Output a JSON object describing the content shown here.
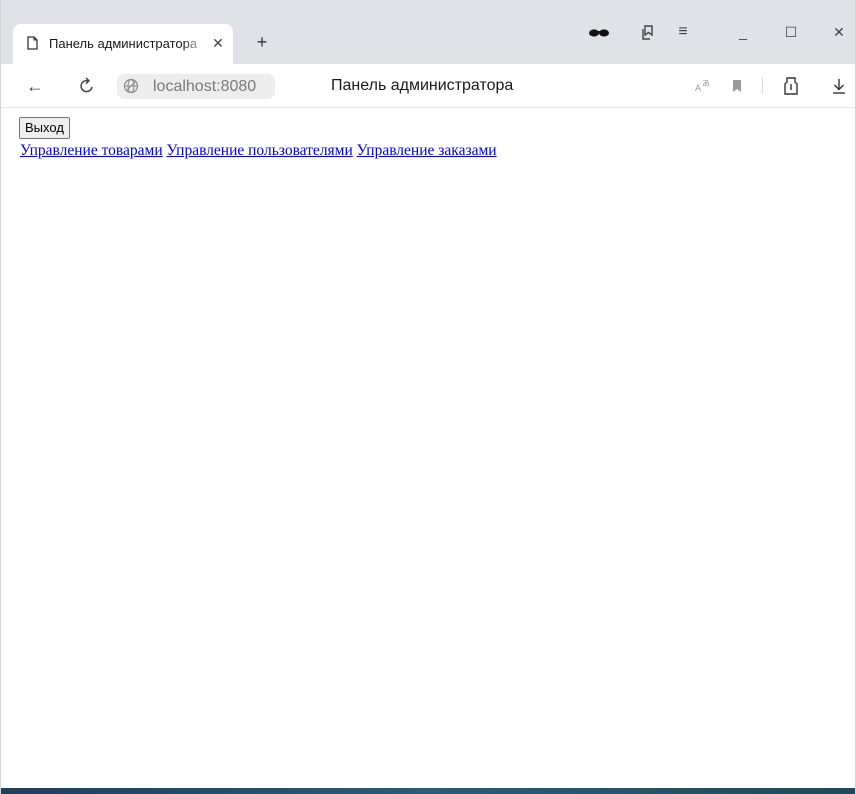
{
  "browser": {
    "tab": {
      "title": "Панель администратора",
      "close_glyph": "✕",
      "icon": "page-icon"
    },
    "new_tab_glyph": "+",
    "window_controls": {
      "incognito_icon": "glasses-icon",
      "collections_icon": "collections-icon",
      "menu_glyph": "≡",
      "minimize_glyph": "_",
      "maximize_glyph": "☐",
      "close_glyph": "✕"
    },
    "toolbar": {
      "back_glyph": "←",
      "reload_glyph": "↻",
      "address": "localhost:8080",
      "page_title": "Панель администратора",
      "download_glyph": "↓",
      "icons": [
        "back-icon",
        "reload-icon",
        "globe-icon",
        "translate-icon",
        "bookmark-icon",
        "protect-icon",
        "download-icon"
      ]
    }
  },
  "page": {
    "logout_label": "Выход",
    "links": [
      {
        "label": "Управление товарами"
      },
      {
        "label": "Управление пользователями"
      },
      {
        "label": "Управление заказами"
      }
    ],
    "link_color": "#0000ee"
  },
  "colors": {
    "tabstrip_bg": "#dfe3e8",
    "url_pill_bg": "#ededed",
    "url_text": "#7a7a7a"
  }
}
